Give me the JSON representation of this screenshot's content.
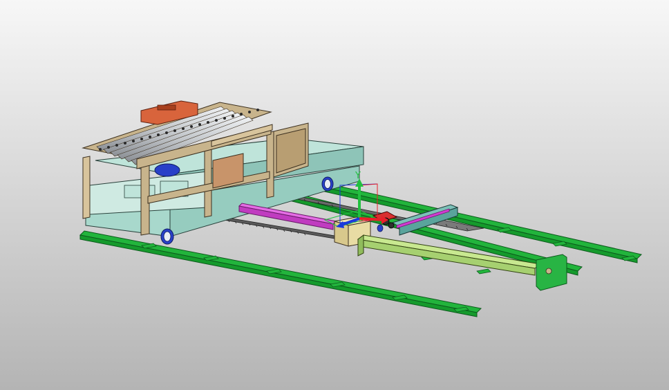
{
  "viewport": {
    "background_top": "#f7f7f7",
    "background_bottom": "#b4b4b4"
  },
  "triad": {
    "y_label": "Y",
    "x_color": "#e8202a",
    "y_color": "#22c040",
    "z_color": "#1a3adc"
  },
  "colors": {
    "rail": "#22b43c",
    "rail_edge": "#0c5a1c",
    "frame": "#c8b48c",
    "frame_edge": "#3c3020",
    "base": "#a8d8cc",
    "roller": "#d4d8dc",
    "orange_block": "#d8643c",
    "magenta": "#d23cd2",
    "yellow_green": "#b4dc78",
    "cyan_gray": "#6ab4aa",
    "wheel": "#2840c8"
  }
}
